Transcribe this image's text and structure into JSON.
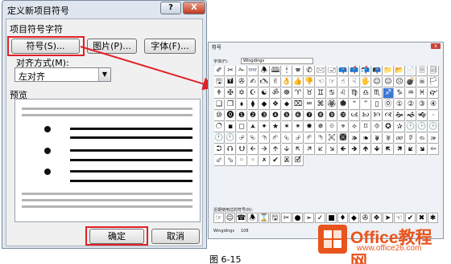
{
  "dialog": {
    "title": "定义新项目符号",
    "help_label": "?",
    "close_label": "X",
    "group_label": "项目符号字符",
    "symbol_button": "符号(S)...",
    "picture_button": "图片(P)...",
    "font_button": "字体(F)...",
    "align_label": "对齐方式(M):",
    "align_value": "左对齐",
    "preview_label": "预览",
    "ok_button": "确定",
    "cancel_button": "取消"
  },
  "symbol_window": {
    "title": "符号",
    "font_label": "字体(F):",
    "font_value": "Wingdings",
    "recent_label": "近期使用过的符号(R):",
    "status_font": "Wingdings",
    "status_code": "108"
  },
  "symbol_grid": [
    "✐✂✁👓🕭🕮🕯🕿✆🖂🖃📪📫📬📭📁📂📄🗏🗐🗄⌛🖮🖰🖲🖳🖴",
    "🖫🖬✇✍🖎✌👌👍👎☜☞☝☟🖐☺😐☹💣☠🏳🏱✈☼💧❄🕆✞",
    "🕈✠✡☪☯ॐ☸♈♉♊♋♌♍♎♏♐♑♒♓🙰🙵●🔾■□◻",
    "❑❒⬧⧫◆❖⬥⌧⮹⌘🏵🏶🙶🙷▯⓪①②③④⑤⑥⑦⑧⑨",
    "⑩⓿❶❷❸❹❺❻❼❽❾❿🙢🙠🙡🙣🙞🙜🙝·•▪⚪🞆🞈◉◎",
    "🔿▪◻🟂✦★✶✴✹✵⯐⌖⟡⌑⯑✪✰🕐🕑🕒🕓🕔🕕🕖🕗🕘🕙",
    "🕚🕛⮰⮱⮲⮳⮴⮵⮶⮷🙪🙫🙕🙔🙗🙖🙐🙑🙒🙓⌫⌦⮘⮚⮙⮛⮈",
    "⮊⮉⮋🡨🡪🡩🡫🡬🡭🡯🡮🡸🡺🡹🡻🡼🡽🡿🡾⇦⇨⇧⇩⬄⇳⬀⬁",
    "⬃⬂🢬🢭🗶✔🗷🗹"
  ],
  "recent_symbols": "☞☺☎🕭⌛🖫✂●➢✓■♦◆✇❖➤☜✔✖✱★◆🕱💬©",
  "logo": {
    "main": "Office教程网",
    "sub": "www.office26.com"
  },
  "caption": "图 6-15",
  "colors": {
    "highlight_red": "#e21f26",
    "arrow_red": "#e21f26",
    "logo_orange": "#e8541e",
    "selected_cell": "#3a78d8"
  }
}
